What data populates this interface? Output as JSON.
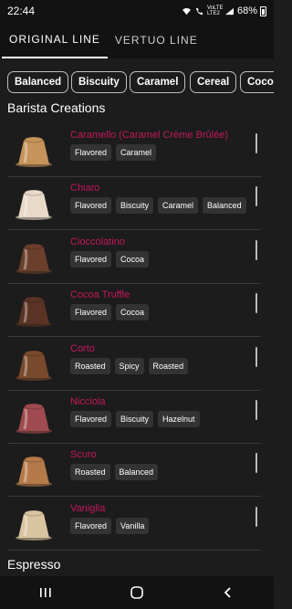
{
  "status_bar": {
    "time": "22:44",
    "network": "VoLTE LTE2",
    "battery": "68%"
  },
  "tabs": [
    {
      "label": "ORIGINAL LINE",
      "active": true
    },
    {
      "label": "VERTUO LINE",
      "active": false
    }
  ],
  "filters": [
    "Balanced",
    "Biscuity",
    "Caramel",
    "Cereal",
    "Cocoa"
  ],
  "sections": [
    {
      "title": "Barista Creations",
      "items": [
        {
          "name": "Caramello (Caramel Crème Brûlée)",
          "tags": [
            "Flavored",
            "Caramel"
          ],
          "color": "#c6935a"
        },
        {
          "name": "Chiaro",
          "tags": [
            "Flavored",
            "Biscuity",
            "Caramel",
            "Balanced"
          ],
          "color": "#e8d9c8"
        },
        {
          "name": "Cioccolatino",
          "tags": [
            "Flavored",
            "Cocoa"
          ],
          "color": "#6b3f2c"
        },
        {
          "name": "Cocoa Truffle",
          "tags": [
            "Flavored",
            "Cocoa"
          ],
          "color": "#5a3324"
        },
        {
          "name": "Corto",
          "tags": [
            "Roasted",
            "Spicy",
            "Roasted"
          ],
          "color": "#7a4a2d"
        },
        {
          "name": "Nicciola",
          "tags": [
            "Flavored",
            "Biscuity",
            "Hazelnut"
          ],
          "color": "#9e4a4e"
        },
        {
          "name": "Scuro",
          "tags": [
            "Roasted",
            "Balanced"
          ],
          "color": "#b57a4a"
        },
        {
          "name": "Vaniglia",
          "tags": [
            "Flavored",
            "Vanilla"
          ],
          "color": "#d9c4a0"
        }
      ]
    },
    {
      "title": "Espresso",
      "items": []
    }
  ]
}
